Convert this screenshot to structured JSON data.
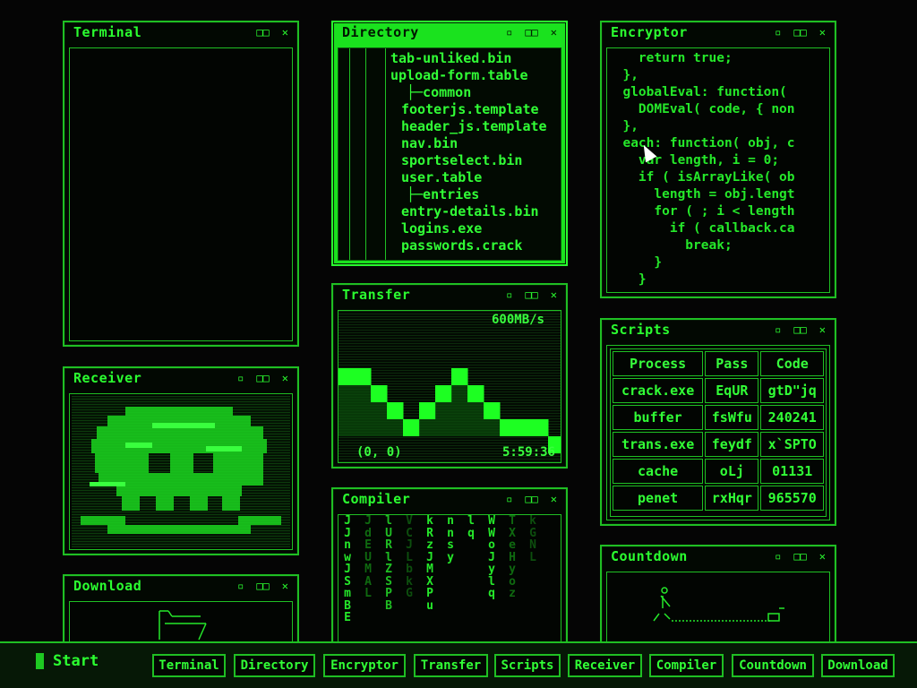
{
  "windows": {
    "terminal": {
      "title": "Terminal",
      "ctrl_max": "□□",
      "ctrl_close": "✕"
    },
    "directory": {
      "title": "Directory",
      "ctrl_min": "▫",
      "ctrl_max": "□□",
      "ctrl_close": "✕",
      "lines": [
        "tab-unliked.bin",
        "upload-form.table",
        "├─common",
        "footerjs.template",
        "header_js.template",
        "nav.bin",
        "sportselect.bin",
        "user.table",
        "├─entries",
        "entry-details.bin",
        "logins.exe",
        "passwords.crack"
      ]
    },
    "encryptor": {
      "title": "Encryptor",
      "ctrl_min": "▫",
      "ctrl_max": "□□",
      "ctrl_close": "✕",
      "code": [
        "    return true;",
        "  },",
        "  globalEval: function(",
        "    DOMEval( code, { non",
        "  },",
        "  each: function( obj, c",
        "    var length, i = 0;",
        "    if ( isArrayLike( ob",
        "      length = obj.lengt",
        "      for ( ; i < length",
        "        if ( callback.ca",
        "          break;",
        "      }",
        "    }"
      ]
    },
    "transfer": {
      "title": "Transfer",
      "ctrl_min": "▫",
      "ctrl_max": "□□",
      "ctrl_close": "✕",
      "speed": "600MB/s",
      "coords": "(0, 0)",
      "time": "5:59:36",
      "levels": [
        3,
        3,
        2,
        1,
        0,
        1,
        2,
        3,
        2,
        1,
        0,
        0,
        0,
        -1
      ]
    },
    "receiver": {
      "title": "Receiver",
      "ctrl_min": "▫",
      "ctrl_max": "□□",
      "ctrl_close": "✕"
    },
    "compiler": {
      "title": "Compiler",
      "ctrl_min": "▫",
      "ctrl_max": "□□",
      "ctrl_close": "✕",
      "columns": [
        "JJnwJSmBE",
        "JdEUMAL",
        "lURlZSPB",
        "VCJLbkG",
        "kRzJMXPu",
        "nnsy",
        "lq",
        "WWoJylq",
        "TXeHyoz",
        "kGNL"
      ]
    },
    "scripts": {
      "title": "Scripts",
      "ctrl_min": "▫",
      "ctrl_max": "□□",
      "ctrl_close": "✕",
      "headers": [
        "Process",
        "Pass",
        "Code"
      ],
      "rows": [
        [
          "crack.exe",
          "EqUR",
          "gtD\"jq"
        ],
        [
          "buffer",
          "fsWfu",
          "240241"
        ],
        [
          "trans.exe",
          "feydf",
          "x`SPTO"
        ],
        [
          "cache",
          "oLj",
          "01131"
        ],
        [
          "penet",
          "rxHqr",
          "965570"
        ]
      ]
    },
    "countdown": {
      "title": "Countdown",
      "ctrl_min": "▫",
      "ctrl_max": "□□",
      "ctrl_close": "✕"
    },
    "download": {
      "title": "Download",
      "ctrl_min": "▫",
      "ctrl_max": "□□",
      "ctrl_close": "✕"
    }
  },
  "taskbar": {
    "start_label": "Start",
    "buttons": [
      "Terminal",
      "Directory",
      "Encryptor",
      "Transfer",
      "Scripts",
      "Receiver",
      "Compiler",
      "Countdown",
      "Download"
    ]
  }
}
